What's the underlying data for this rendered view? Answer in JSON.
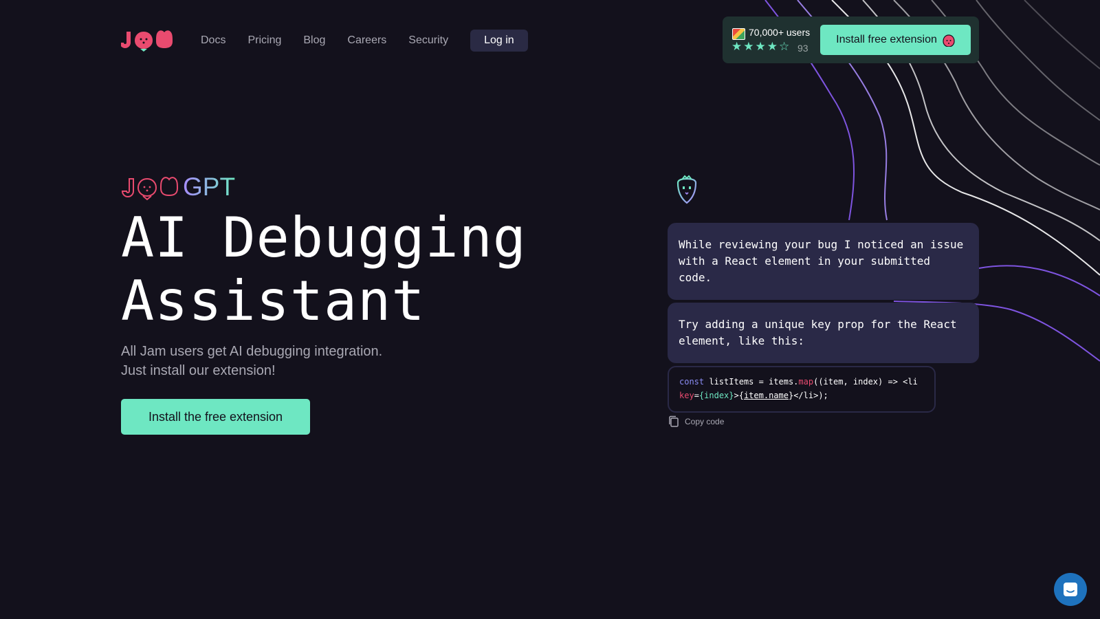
{
  "nav": {
    "items": [
      "Docs",
      "Pricing",
      "Blog",
      "Careers",
      "Security"
    ],
    "login_label": "Log in"
  },
  "extension_card": {
    "users_text": "70,000+ users",
    "rating_stars": 4.5,
    "rating_count": "93",
    "install_label": "Install free extension"
  },
  "hero": {
    "brand_suffix": "GPT",
    "title_line1": "AI Debugging",
    "title_line2": "Assistant",
    "subtitle_line1": "All Jam users get AI debugging integration.",
    "subtitle_line2": "Just install our extension!",
    "cta_label": "Install the free extension"
  },
  "chat": {
    "message1": "While reviewing your bug I noticed an issue with a React element in your submitted code.",
    "message2": "Try adding a unique key prop for the React element, like this:",
    "code": {
      "t1": "const",
      "t2": " listItems = items.",
      "t3": "map",
      "t4": "((item, index) => <li ",
      "t5": "key",
      "t6": "=",
      "t7": "{index}",
      "t8": ">{",
      "t9": "item.name",
      "t10": "}</li>);"
    },
    "copy_label": "Copy code"
  },
  "colors": {
    "background": "#13111c",
    "accent_green": "#6ee7c2",
    "brand_pink": "#e94b6f",
    "bubble_bg": "#2a2947",
    "purple": "#a78bfa"
  },
  "icons": [
    "jam-logo",
    "chrome-icon",
    "star-icon",
    "strawberry-icon",
    "jam-gpt-logo",
    "bot-icon",
    "copy-icon",
    "chat-icon"
  ]
}
